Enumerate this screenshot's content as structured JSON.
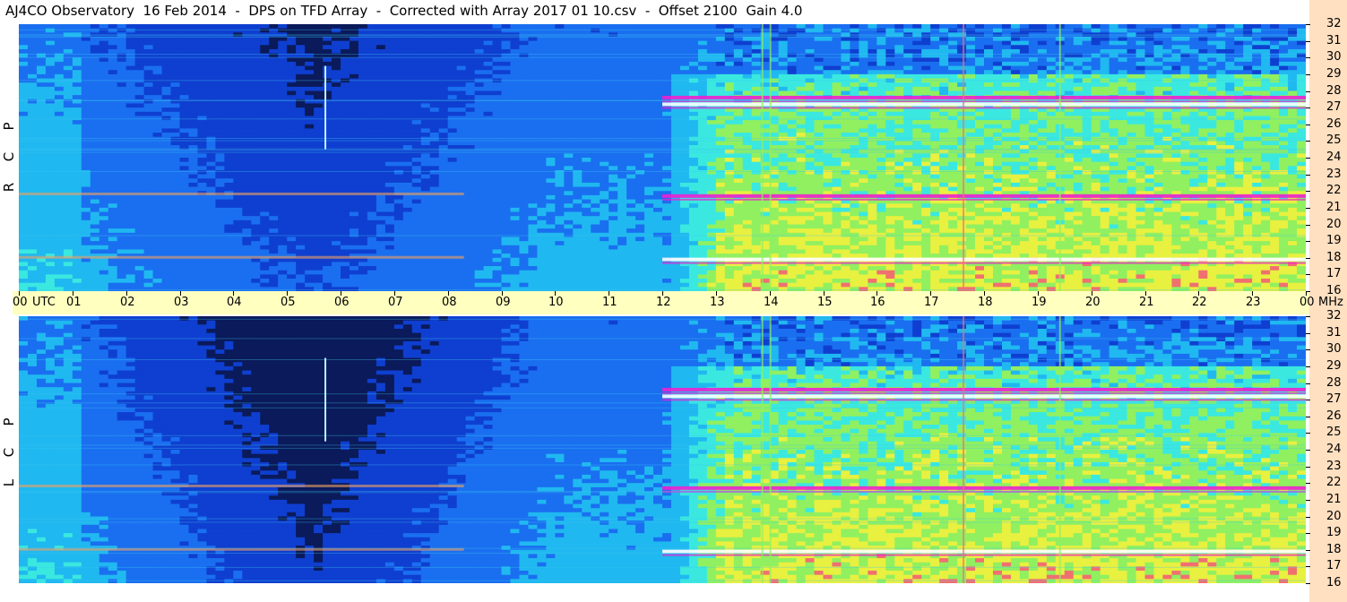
{
  "title": "AJ4CO Observatory  16 Feb 2014  -  DPS on TFD Array  -  Corrected with Array 2017 01 10.csv  -  Offset 2100  Gain 4.0",
  "chart_data": {
    "type": "heatmap",
    "title": "AJ4CO Observatory  16 Feb 2014  -  DPS on TFD Array  -  Corrected with Array 2017 01 10.csv  -  Offset 2100  Gain 4.0",
    "x_axis": {
      "unit_label": "UTC",
      "range_hours": [
        0,
        24
      ],
      "tick_labels": [
        "00",
        "01",
        "02",
        "03",
        "04",
        "05",
        "06",
        "07",
        "08",
        "09",
        "10",
        "11",
        "12",
        "13",
        "14",
        "15",
        "16",
        "17",
        "18",
        "19",
        "20",
        "21",
        "22",
        "23",
        "00"
      ]
    },
    "y_axis": {
      "unit_label": "MHz",
      "range_mhz": [
        16,
        32
      ],
      "tick_labels": [
        "32",
        "31",
        "30",
        "29",
        "28",
        "27",
        "26",
        "25",
        "24",
        "23",
        "22",
        "21",
        "20",
        "19",
        "18",
        "17",
        "16"
      ]
    },
    "panels": [
      {
        "name": "R C P",
        "letters": [
          "R",
          "C",
          "P"
        ]
      },
      {
        "name": "L C P",
        "letters": [
          "L",
          "C",
          "P"
        ]
      }
    ],
    "colormap": [
      "#0a1a5a",
      "#0f3fd0",
      "#1a6ff0",
      "#20b8f0",
      "#3ae8e0",
      "#90f060",
      "#e8f040",
      "#f07070",
      "#f020d0",
      "#ffffff"
    ],
    "features": {
      "night_dark_hours": [
        3,
        9
      ],
      "day_noise_start_hour": 12,
      "spike_hour": 5.7,
      "vertical_lines_hours": [
        13.85,
        14.0,
        17.6,
        19.4
      ],
      "bright_bands_mhz_day": [
        27.2,
        21.7,
        17.9,
        27.6
      ],
      "night_bands_mhz": [
        18.0,
        21.8
      ]
    }
  }
}
